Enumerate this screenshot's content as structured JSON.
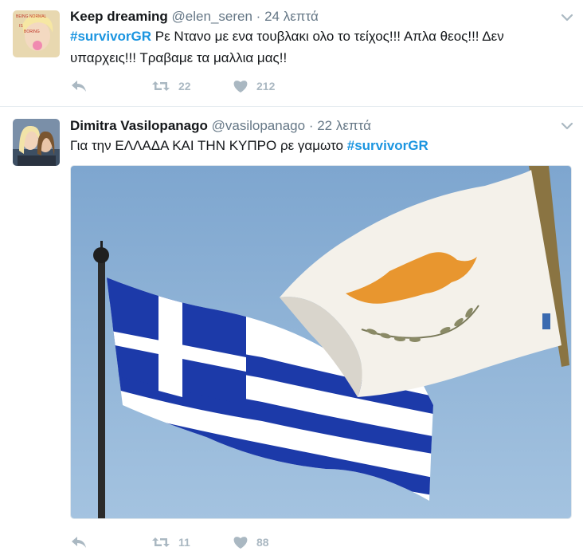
{
  "tweets": [
    {
      "name": "Keep dreaming",
      "handle": "@elen_seren",
      "separator": "·",
      "time": "24 λεπτά",
      "text_before": "",
      "hashtag": "#survivorGR",
      "text_after": " Ρε Ντανο με ενα τουβλακι ολο το τείχος!!! Απλα θεος!!! Δεν υπαρχεις!!! Τραβαμε τα μαλλια μας!!",
      "avatar_caption_top": "BEING NORMAL",
      "avatar_caption_mid": "IS",
      "avatar_caption_bottom": "BORING",
      "retweets": "22",
      "likes": "212"
    },
    {
      "name": "Dimitra Vasilopanago",
      "handle": "@vasilopanago",
      "separator": "·",
      "time": "22 λεπτά",
      "text_before": "Για την ΕΛΛΑΔΑ ΚΑΙ ΤΗΝ ΚΥΠΡΟ ρε γαμωτο ",
      "hashtag": "#survivorGR",
      "text_after": "",
      "retweets": "11",
      "likes": "88"
    }
  ],
  "colors": {
    "hashtag": "#1b95e0",
    "action_gray": "#aab8c2",
    "meta_gray": "#657786",
    "sky": "#8fb4d6"
  },
  "icons": [
    "reply-icon",
    "retweet-icon",
    "like-icon",
    "chevron-down-icon"
  ]
}
